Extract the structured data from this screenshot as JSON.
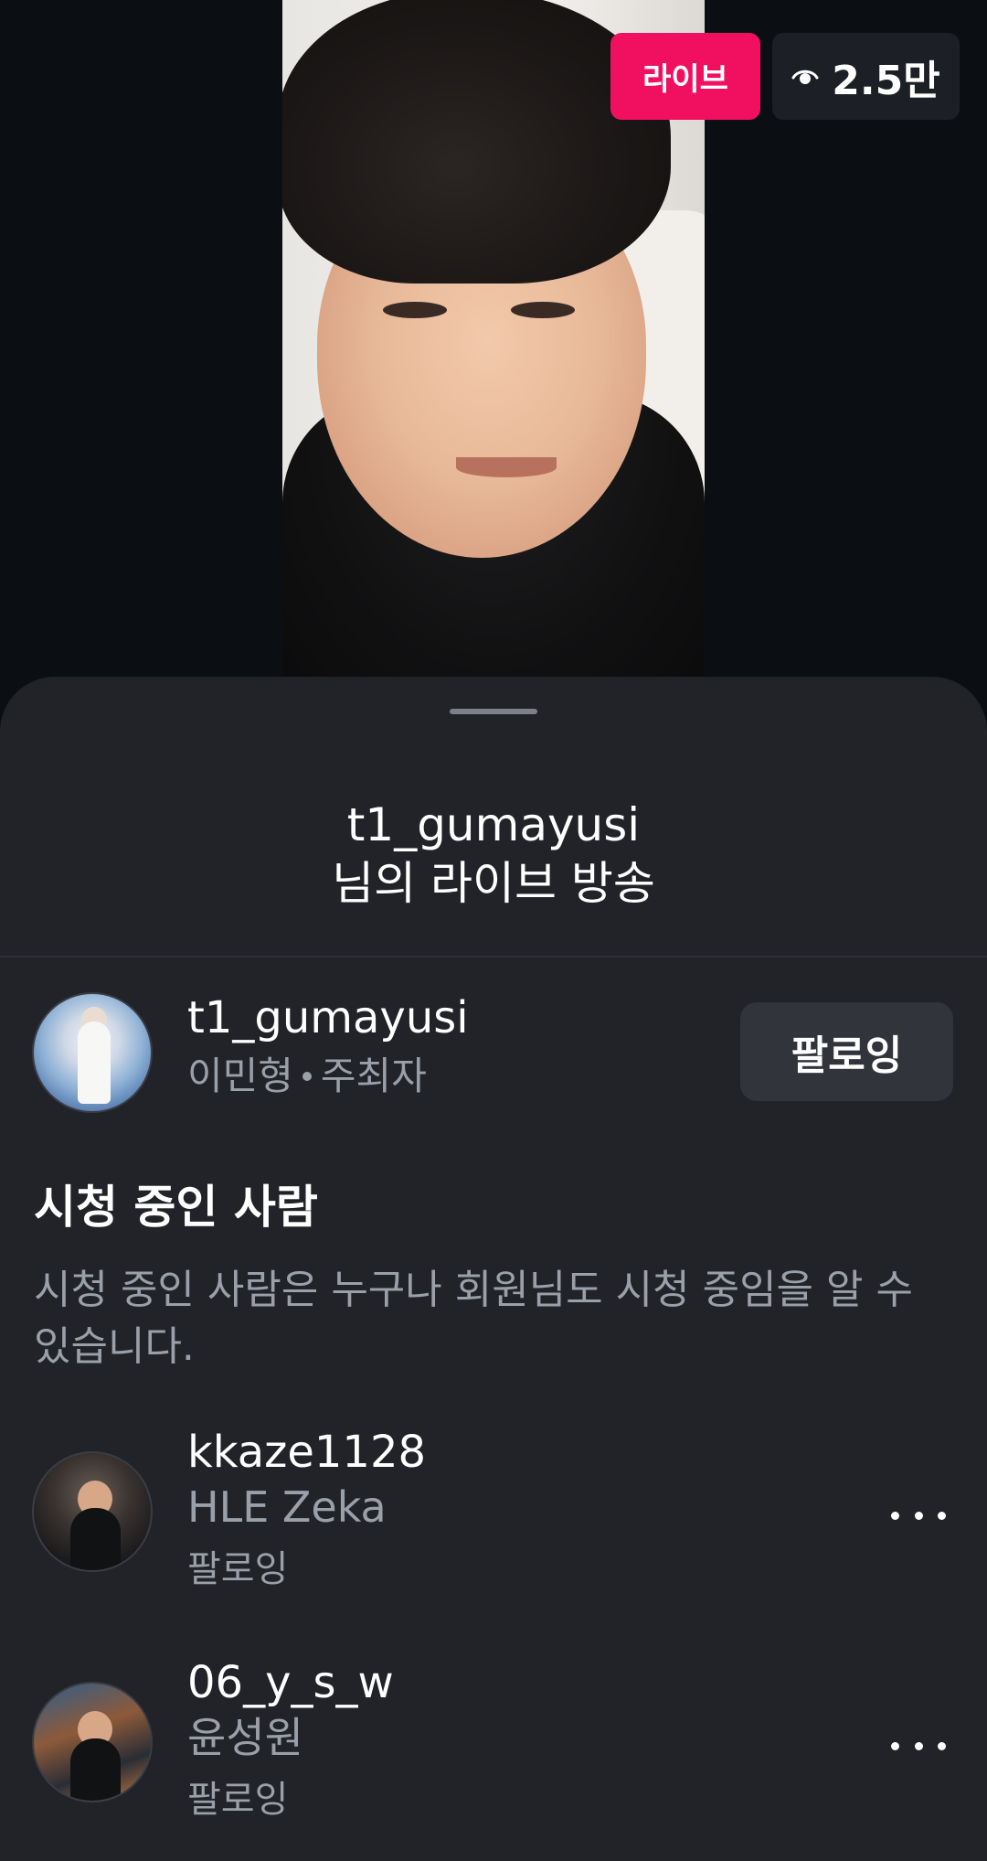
{
  "live": {
    "badge_label": "라이브",
    "viewer_count": "2.5만",
    "viewer_icon": "eye-icon",
    "badge_color": "#f0105f"
  },
  "sheet": {
    "title_line1": "t1_gumayusi",
    "title_line2": "님의 라이브 방송"
  },
  "host": {
    "username": "t1_gumayusi",
    "name": "이민형",
    "role": "주최자",
    "follow_label": "팔로잉"
  },
  "viewers_section": {
    "title": "시청 중인 사람",
    "description": "시청 중인 사람은 누구나 회원님도 시청 중임을 알 수 있습니다."
  },
  "viewers": [
    {
      "username": "kkaze1128",
      "name": "HLE Zeka",
      "status": "팔로잉"
    },
    {
      "username": "06_y_s_w",
      "name": "윤성원",
      "status": "팔로잉"
    }
  ]
}
